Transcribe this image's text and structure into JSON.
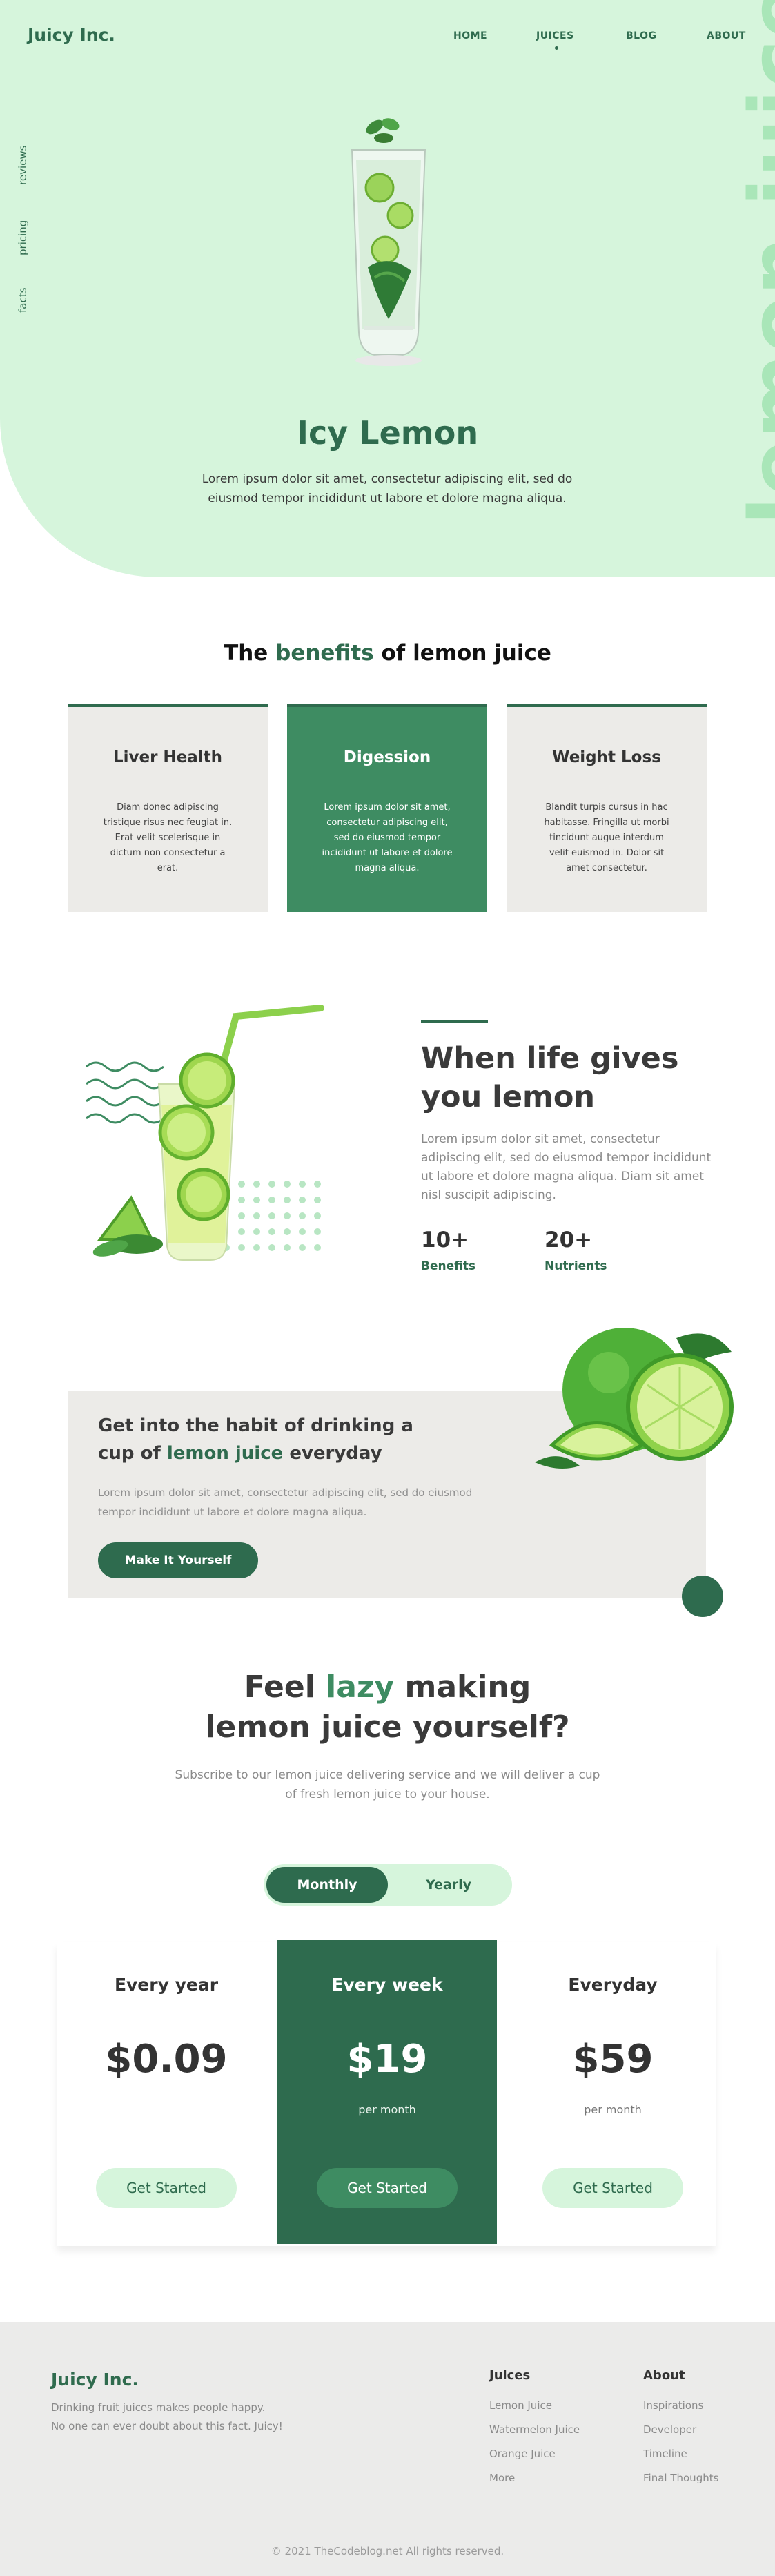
{
  "header": {
    "logo": "Juicy Inc.",
    "nav": [
      "HOME",
      "JUICES",
      "BLOG",
      "ABOUT"
    ],
    "active_nav": "JUICES"
  },
  "side_links": [
    "reviews",
    "pricing",
    "facts"
  ],
  "hero": {
    "vertical_word": "lemon juice",
    "title": "Icy Lemon",
    "description": "Lorem ipsum dolor sit amet, consectetur adipiscing elit, sed do eiusmod tempor incididunt ut labore et dolore magna aliqua."
  },
  "benefits": {
    "title_pre": "The ",
    "title_hl": "benefits",
    "title_post": " of lemon juice",
    "cards": [
      {
        "title": "Liver Health",
        "text": "Diam donec adipiscing tristique risus nec feugiat in. Erat velit scelerisque in dictum non consectetur a erat."
      },
      {
        "title": "Digession",
        "text": "Lorem ipsum dolor sit amet, consectetur adipiscing elit, sed do eiusmod tempor incididunt ut labore et dolore magna aliqua."
      },
      {
        "title": "Weight Loss",
        "text": "Blandit turpis cursus in hac habitasse. Fringilla ut morbi tincidunt augue interdum velit euismod in. Dolor sit amet consectetur."
      }
    ]
  },
  "life": {
    "title": "When life gives you lemon",
    "description": "Lorem ipsum dolor sit amet, consectetur adipiscing elit, sed do eiusmod tempor incididunt ut labore et dolore magna aliqua. Diam sit amet nisl suscipit adipiscing.",
    "stats": [
      {
        "number": "10+",
        "label": "Benefits"
      },
      {
        "number": "20+",
        "label": "Nutrients"
      }
    ]
  },
  "habit": {
    "title_line1": "Get into the habit of drinking  a",
    "title_pre": "cup of ",
    "title_hl": "lemon juice",
    "title_post": " everyday",
    "description": "Lorem ipsum dolor sit amet, consectetur adipiscing elit, sed do eiusmod tempor incididunt ut labore et dolore magna aliqua.",
    "button": "Make It Yourself"
  },
  "lazy": {
    "title_pre": "Feel ",
    "title_hl": "lazy",
    "title_post": " making",
    "title_line2": "lemon juice yourself?",
    "description": "Subscribe to our lemon juice delivering service and we will deliver a cup of fresh lemon juice to your house."
  },
  "billing_toggle": {
    "options": [
      "Monthly",
      "Yearly"
    ],
    "selected": "Monthly"
  },
  "plans": [
    {
      "name": "Every year",
      "price": "$0.09",
      "period": "",
      "cta": "Get Started"
    },
    {
      "name": "Every week",
      "price": "$19",
      "period": "per month",
      "cta": "Get Started"
    },
    {
      "name": "Everyday",
      "price": "$59",
      "period": "per month",
      "cta": "Get Started"
    }
  ],
  "footer": {
    "logo": "Juicy Inc.",
    "desc_line1": "Drinking fruit juices makes people happy.",
    "desc_line2": "No one can ever doubt about this fact. Juicy!",
    "columns": [
      {
        "heading": "Juices",
        "links": [
          "Lemon Juice",
          "Watermelon Juice",
          "Orange Juice",
          "More"
        ]
      },
      {
        "heading": "About",
        "links": [
          "Inspirations",
          "Developer",
          "Timeline",
          "Final Thoughts"
        ]
      }
    ],
    "copyright": "© 2021 TheCodeblog.net All rights reserved."
  },
  "colors": {
    "primary": "#2f6b4e",
    "accent": "#3e8c62",
    "mint": "#d6f5dc",
    "panel": "#ecebe8"
  }
}
